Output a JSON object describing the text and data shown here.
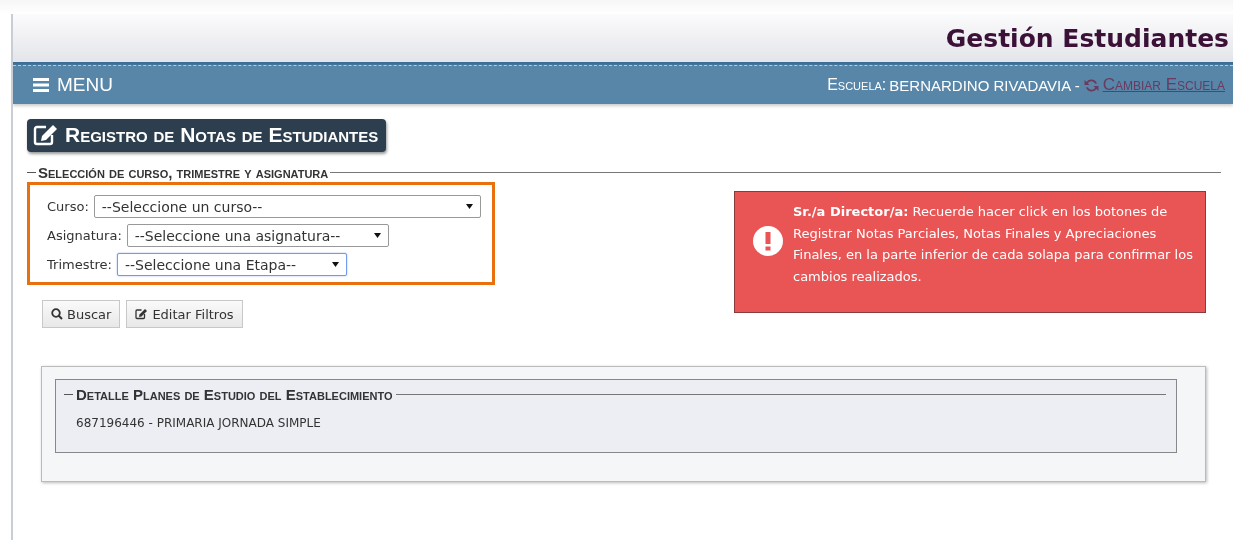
{
  "header": {
    "title": "Gestión Estudiantes"
  },
  "navbar": {
    "menu_label": "MENU",
    "school_label": "Escuela:",
    "school_name": "BERNARDINO RIVADAVIA -",
    "change_link": "Cambiar Escuela"
  },
  "page_title": "Registro de Notas de Estudiantes",
  "selection": {
    "legend": "Selección de curso, trimestre y asignatura",
    "filters": [
      {
        "label": "Curso:",
        "value": "--Seleccione un curso--",
        "focused": false
      },
      {
        "label": "Asignatura:",
        "value": "--Seleccione una asignatura--",
        "focused": false
      },
      {
        "label": "Trimestre:",
        "value": "--Seleccione una Etapa--",
        "focused": true
      }
    ],
    "buttons": [
      {
        "kind": "search",
        "label": "Buscar"
      },
      {
        "kind": "edit",
        "label": "Editar Filtros"
      }
    ]
  },
  "alert": {
    "text": "**Sr./a Director/a:** Recuerde hacer click en los botones de Registrar Notas Parciales, Notas Finales y Apreciaciones Finales, en la parte inferior de cada solapa para confirmar los cambios realizados."
  },
  "detail": {
    "legend": "Detalle Planes de Estudio del Establecimiento",
    "items": [
      "687196446 - PRIMARIA JORNADA SIMPLE"
    ]
  }
}
